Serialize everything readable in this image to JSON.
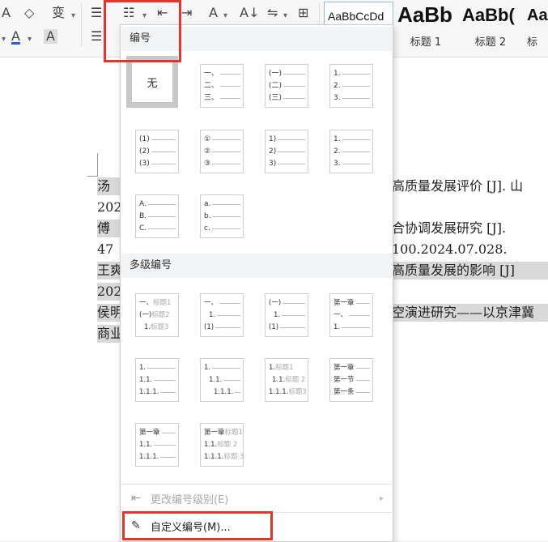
{
  "ribbon": {
    "row1": [
      "A",
      "◇",
      "变",
      "☰",
      "☷",
      "⇤",
      "⇥",
      "A",
      "A↓",
      "⇋",
      "⊞"
    ],
    "row2": [
      "A",
      "A",
      "A",
      "☰"
    ],
    "styles": [
      {
        "preview": "AaBbCcDd",
        "label": ""
      },
      {
        "preview": "AaBb",
        "label": "标题 1"
      },
      {
        "preview": "AaBb(",
        "label": "标题 2"
      },
      {
        "preview": "Aa",
        "label": "标"
      }
    ]
  },
  "document": {
    "lines": [
      {
        "left": "汤",
        "right": "高质量发展评价    [J].   山"
      },
      {
        "left": "202",
        "right": ""
      },
      {
        "left": "  傅",
        "right": "合协调发展研究      [J]."
      },
      {
        "left": "47",
        "right": "100.2024.07.028."
      },
      {
        "left": "王爽",
        "right": "高质量发展的影响       [J]"
      },
      {
        "left": "202",
        "right": ""
      },
      {
        "left": "侯明",
        "right": "空演进研究——以京津冀"
      },
      {
        "left": "商业",
        "right": ""
      }
    ]
  },
  "dropdown": {
    "section_numbering": "编号",
    "section_multilevel": "多级编号",
    "none_label": "无",
    "numbering_tiles": [
      [
        "一、",
        "二、",
        "三、"
      ],
      [
        "(一)",
        "(二)",
        "(三)"
      ],
      [
        "1.",
        "2.",
        "3."
      ],
      [
        "(1)",
        "(2)",
        "(3)"
      ],
      [
        "①",
        "②",
        "③"
      ],
      [
        "1)",
        "2)",
        "3)"
      ],
      [
        "1.",
        "2.",
        "3."
      ],
      [
        "A.",
        "B.",
        "C."
      ],
      [
        "a.",
        "b.",
        "c."
      ]
    ],
    "multilevel_tiles": [
      [
        {
          "p": "一、",
          "g": "标题1"
        },
        {
          "p": "(一)",
          "g": "标题2"
        },
        {
          "p": "1.",
          "g": "标题3"
        }
      ],
      [
        {
          "p": "一、",
          "g": ""
        },
        {
          "p": "1.",
          "g": ""
        },
        {
          "p": "(1)",
          "g": ""
        }
      ],
      [
        {
          "p": "(一)",
          "g": ""
        },
        {
          "p": "1.",
          "g": ""
        },
        {
          "p": "(1)",
          "g": ""
        }
      ],
      [
        {
          "p": "第一章",
          "g": ""
        },
        {
          "p": "一、",
          "g": ""
        },
        {
          "p": "1.",
          "g": ""
        }
      ],
      [
        {
          "p": "1.",
          "g": ""
        },
        {
          "p": "1.1.",
          "g": ""
        },
        {
          "p": "1.1.1.",
          "g": ""
        }
      ],
      [
        {
          "p": "1.",
          "g": ""
        },
        {
          "p": "1.1.",
          "g": ""
        },
        {
          "p": "1.1.1.",
          "g": ""
        }
      ],
      [
        {
          "p": "1.",
          "g": "标题1"
        },
        {
          "p": "1.1.",
          "g": "标题 2"
        },
        {
          "p": "1.1.1.",
          "g": "标题3"
        }
      ],
      [
        {
          "p": "第一章",
          "g": ""
        },
        {
          "p": "第一节",
          "g": ""
        },
        {
          "p": "第一条",
          "g": ""
        }
      ],
      [
        {
          "p": "第一章",
          "g": ""
        },
        {
          "p": "1.1.",
          "g": ""
        },
        {
          "p": "1.1.1.",
          "g": ""
        }
      ],
      [
        {
          "p": "第一章",
          "g": "标题1"
        },
        {
          "p": "1.1.",
          "g": "标题 2"
        },
        {
          "p": "1.1.1.",
          "g": "标题 3"
        }
      ]
    ],
    "change_level_label": "更改编号级别(E)",
    "custom_label": "自定义编号(M)...",
    "change_level_icon": "change-level-icon",
    "custom_icon": "pencil-icon"
  },
  "colors": {
    "highlight": "#e0362c",
    "font_underline": "#2a5bd7"
  }
}
